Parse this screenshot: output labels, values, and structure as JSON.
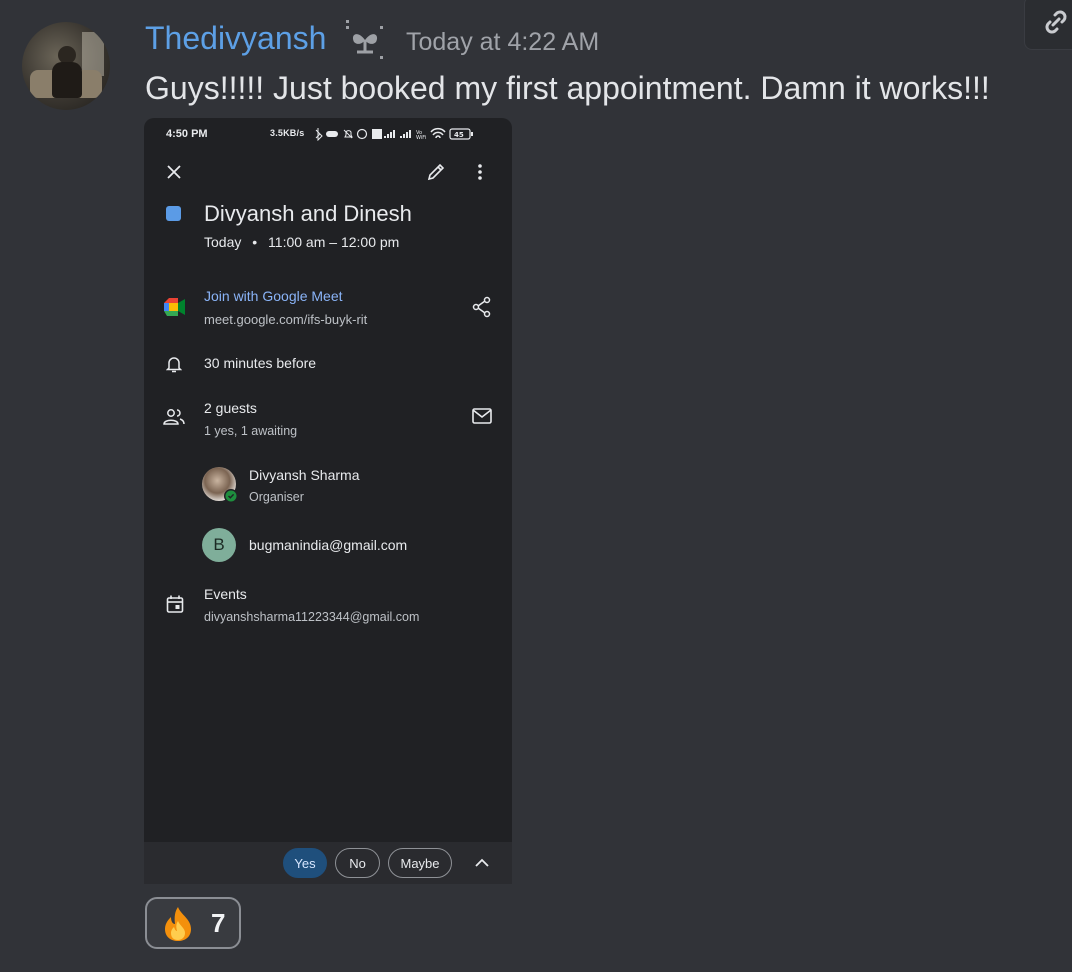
{
  "author": {
    "name": "Thedivyansh",
    "timestamp": "Today at 4:22 AM"
  },
  "message": {
    "text": "Guys!!!!! Just booked my first appointment. Damn it works!!!"
  },
  "attachment": {
    "status_bar": {
      "time": "4:50 PM",
      "indicators": "3.5KB/s",
      "battery": "45"
    },
    "event": {
      "title": "Divyansh and Dinesh",
      "day": "Today",
      "time_range": "11:00 am – 12:00 pm",
      "calendar_color": "#5b9be6"
    },
    "meet": {
      "label": "Join with Google Meet",
      "url": "meet.google.com/ifs-buyk-rit"
    },
    "reminder": "30 minutes before",
    "guests": {
      "count_label": "2 guests",
      "summary": "1 yes, 1 awaiting",
      "list": [
        {
          "name": "Divyansh Sharma",
          "role": "Organiser"
        },
        {
          "initial": "B",
          "name": "bugmanindia@gmail.com"
        }
      ]
    },
    "calendar": {
      "name": "Events",
      "account": "divyanshsharma11223344@gmail.com"
    },
    "rsvp": {
      "yes": "Yes",
      "no": "No",
      "maybe": "Maybe"
    }
  },
  "reaction": {
    "emoji": "fire-emoji",
    "count": "7"
  }
}
